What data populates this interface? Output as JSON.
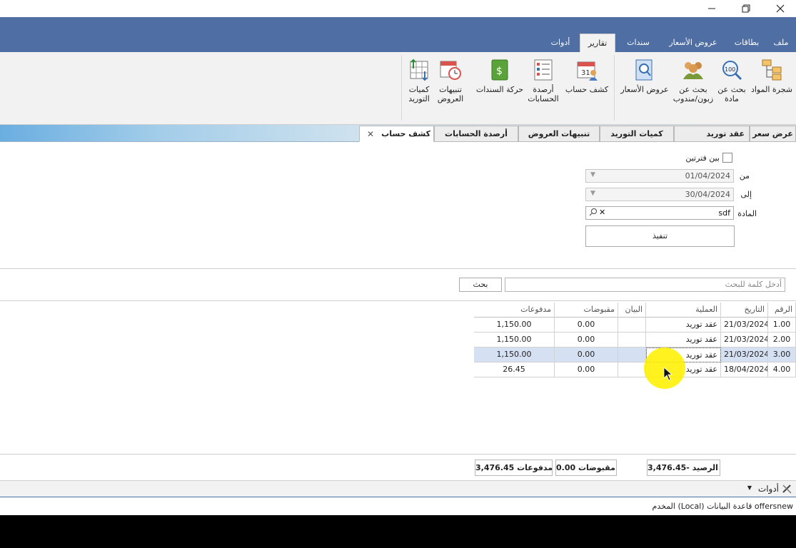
{
  "window": {
    "controls": [
      {
        "name": "minimize",
        "glyph": "—"
      },
      {
        "name": "restore",
        "glyph": "❐"
      },
      {
        "name": "close",
        "glyph": "✕"
      }
    ]
  },
  "ribbon_tabs": [
    {
      "label": "ملف"
    },
    {
      "label": "بطاقات"
    },
    {
      "label": "عروض الأسعار"
    },
    {
      "label": "سندات"
    },
    {
      "label": "تقارير",
      "active": true
    },
    {
      "label": "أدوات"
    }
  ],
  "ribbon_buttons": [
    {
      "label": "شجرة المواد",
      "icon": "tree-icon"
    },
    {
      "label": "بحث عن\nمادة",
      "icon": "search-100-icon"
    },
    {
      "label": "بحث عن\nزبون/مندوب",
      "icon": "people-icon"
    },
    {
      "label": "عروض الأسعار",
      "icon": "offer-search-icon"
    },
    {
      "label": "كشف حساب",
      "icon": "calendar-person-icon"
    },
    {
      "label": "أرصدة\nالحسابات",
      "icon": "list-icon"
    },
    {
      "label": "حركة السندات",
      "icon": "money-book-icon"
    },
    {
      "label": "تنبيهات\nالعروض",
      "icon": "calendar-alarm-icon"
    },
    {
      "label": "كميات\nالتوريد",
      "icon": "table-arrows-icon"
    }
  ],
  "doc_tabs": [
    {
      "label": "عرض سعر"
    },
    {
      "label": "عقد توريد"
    },
    {
      "label": "كميات التوريد"
    },
    {
      "label": "تنبيهات العروض"
    },
    {
      "label": "أرصدة الحسابات"
    },
    {
      "label": "كشف حساب",
      "active": true,
      "close": "✕"
    }
  ],
  "filter": {
    "between_periods_label": "بين فترتين",
    "from_label": "من",
    "from_value": "01/04/2024",
    "to_label": "إلى",
    "to_value": "30/04/2024",
    "item_label": "المادة",
    "item_value": "sdf",
    "execute_label": "تنفيذ"
  },
  "search": {
    "placeholder": "أدخل كلمة للبحث",
    "button_label": "بحث"
  },
  "table": {
    "columns": [
      "الرقم",
      "التاريخ",
      "العملية",
      "البيان",
      "مقبوضات",
      "مدفوعات"
    ],
    "rows": [
      {
        "num": "1.00",
        "date": "21/03/2024",
        "op": "عقد توريد",
        "desc": "",
        "received": "0.00",
        "paid": "1,150.00"
      },
      {
        "num": "2.00",
        "date": "21/03/2024",
        "op": "عقد توريد",
        "desc": "",
        "received": "0.00",
        "paid": "1,150.00"
      },
      {
        "num": "3.00",
        "date": "21/03/2024",
        "op": "عقد توريد",
        "desc": "",
        "received": "0.00",
        "paid": "1,150.00",
        "selected": true
      },
      {
        "num": "4.00",
        "date": "18/04/2024",
        "op": "عقد توريد",
        "desc": "",
        "received": "0.00",
        "paid": "26.45"
      }
    ]
  },
  "totals": {
    "balance": "الرصيد -3,476.45",
    "received": "مقبوضات 0.00",
    "paid": "مدفوعات 3,476.45"
  },
  "tools_menu": {
    "label": "أدوات"
  },
  "status": {
    "text": "المخدم (Local) قاعدة البيانات offersnew"
  },
  "colors": {
    "ribbon": "#4e6ea4",
    "selected_row": "#d5e1f3",
    "highlight": "#ffef00"
  }
}
